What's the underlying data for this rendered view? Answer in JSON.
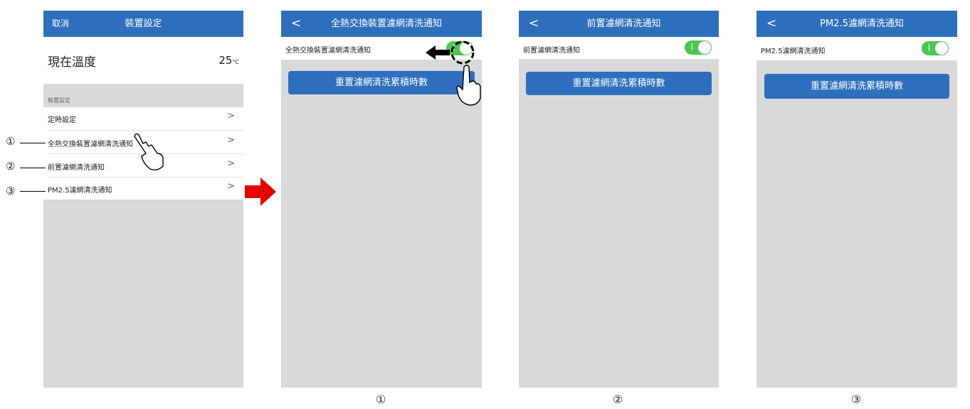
{
  "screen1": {
    "nav_cancel": "取消",
    "nav_title": "裝置設定",
    "temp_label": "現在溫度",
    "temp_value": "25",
    "temp_unit": "°C",
    "section_header": "裝置設定",
    "items": [
      {
        "label": "定時設定"
      },
      {
        "label": "全熱交換裝置濾網清洗通知"
      },
      {
        "label": "前置濾網清洗通知"
      },
      {
        "label": "PM2.5濾網清洗通知"
      }
    ]
  },
  "screen2": {
    "nav_title": "全熱交換裝置濾網清洗通知",
    "toggle_label": "全熱交換裝置濾網清洗通知",
    "toggle_on": true,
    "reset_button": "重置濾網清洗累積時數"
  },
  "screen3": {
    "nav_title": "前置濾網清洗通知",
    "toggle_label": "前置濾網清洗通知",
    "toggle_on": true,
    "reset_button": "重置濾網清洗累積時數"
  },
  "screen4": {
    "nav_title": "PM2.5濾網清洗通知",
    "toggle_label": "PM2.5濾網清洗通知",
    "toggle_on": true,
    "reset_button": "重置濾網清洗累積時數"
  },
  "callouts": [
    "①",
    "②",
    "③"
  ],
  "captions": [
    "①",
    "②",
    "③"
  ],
  "colors": {
    "nav": "#2e6fbd",
    "toggle": "#4cc552",
    "screen_bg": "#d9d9d9",
    "arrow": "#e60000"
  },
  "icons": [
    "back-chevron-icon",
    "chevron-right-icon",
    "tap-hand-icon",
    "red-arrow-icon",
    "swipe-arrow-icon"
  ]
}
